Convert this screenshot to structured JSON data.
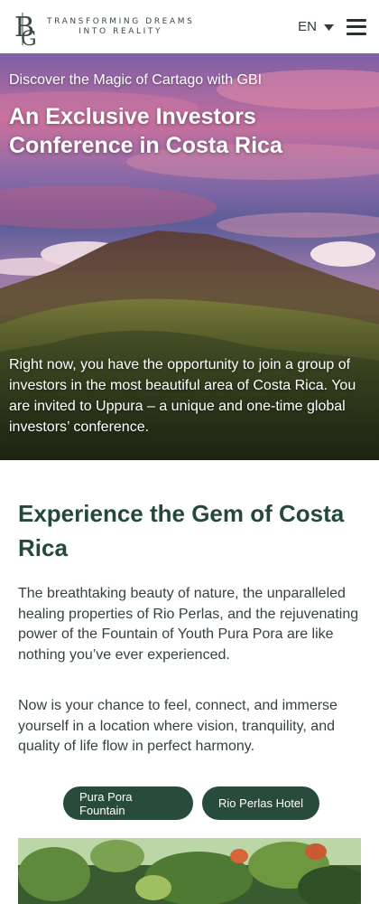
{
  "header": {
    "logo_letters": "BGI",
    "tagline_line1": "TRANSFORMING DREAMS",
    "tagline_line2": "INTO REALITY",
    "language": "EN",
    "icons": [
      "chevron-down-icon",
      "hamburger-menu-icon"
    ]
  },
  "hero": {
    "eyebrow": "Discover the Magic of Cartago with GBI",
    "title": "An Exclusive Investors Conference in Costa Rica",
    "body": "Right now, you have the opportunity to join a group of investors in the most beautiful area of Costa Rica. You are invited to Uppura – a unique and one-time global investors’ conference."
  },
  "section": {
    "title": "Experience the Gem of Costa Rica",
    "paragraph1": "The breathtaking beauty of nature, the unparalleled healing properties of Rio Perlas, and the rejuvenating power of the Fountain of Youth Pura Pora are like nothing you’ve ever experienced.",
    "paragraph2": "Now is your chance to feel, connect, and immerse yourself in a location where vision, tranquility, and quality of life flow in perfect harmony."
  },
  "tabs": {
    "pura_pora": "Pura Pora Fountain",
    "rio_perlas": "Rio Perlas Hotel"
  },
  "colors": {
    "brand_green": "#284b3c",
    "heading_green": "#24493a",
    "text": "#34433b"
  }
}
